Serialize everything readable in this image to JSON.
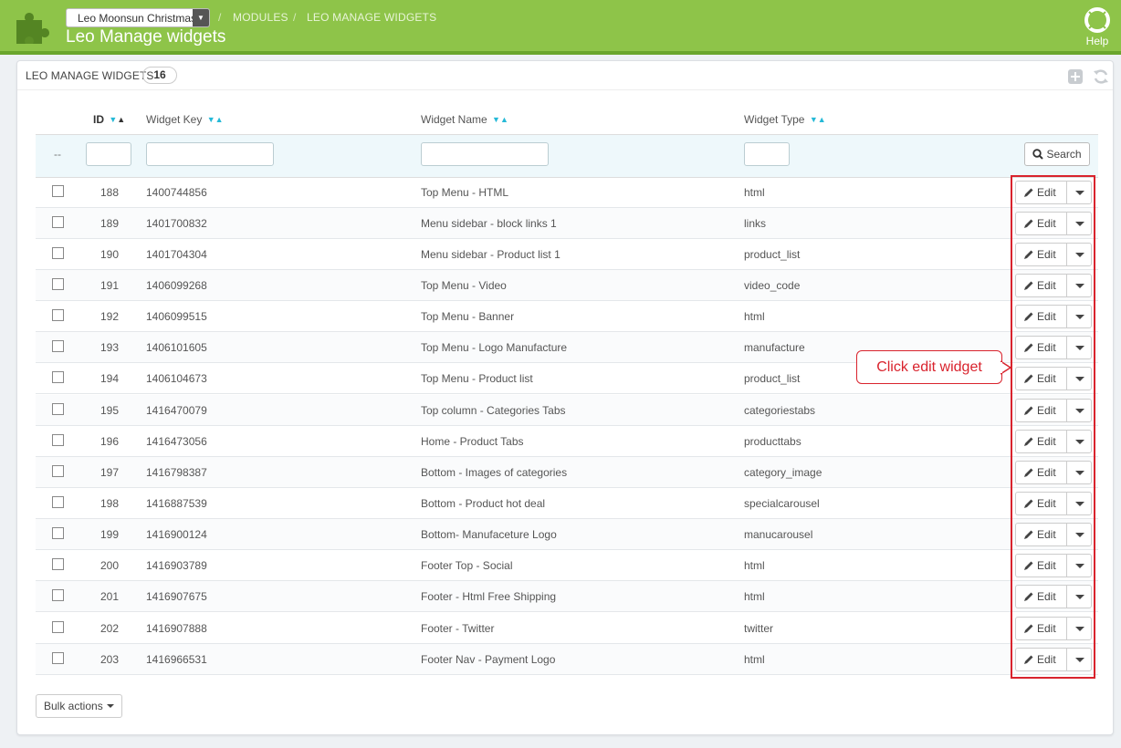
{
  "header": {
    "shop_select": "Leo Moonsun Christmas",
    "breadcrumb": [
      "MODULES",
      "LEO MANAGE WIDGETS"
    ],
    "title": "Leo Manage widgets",
    "help_label": "Help"
  },
  "panel": {
    "title": "LEO MANAGE WIDGETS",
    "count": "16"
  },
  "table": {
    "columns": {
      "id": "ID",
      "widget_key": "Widget Key",
      "widget_name": "Widget Name",
      "widget_type": "Widget Type"
    },
    "filter_dash": "--",
    "search_label": "Search",
    "edit_label": "Edit",
    "rows": [
      {
        "id": "188",
        "key": "1400744856",
        "name": "Top Menu - HTML",
        "type": "html"
      },
      {
        "id": "189",
        "key": "1401700832",
        "name": "Menu sidebar - block links 1",
        "type": "links"
      },
      {
        "id": "190",
        "key": "1401704304",
        "name": "Menu sidebar - Product list 1",
        "type": "product_list"
      },
      {
        "id": "191",
        "key": "1406099268",
        "name": "Top Menu - Video",
        "type": "video_code"
      },
      {
        "id": "192",
        "key": "1406099515",
        "name": "Top Menu - Banner",
        "type": "html"
      },
      {
        "id": "193",
        "key": "1406101605",
        "name": "Top Menu - Logo Manufacture",
        "type": "manufacture"
      },
      {
        "id": "194",
        "key": "1406104673",
        "name": "Top Menu - Product list",
        "type": "product_list"
      },
      {
        "id": "195",
        "key": "1416470079",
        "name": "Top column - Categories Tabs",
        "type": "categoriestabs"
      },
      {
        "id": "196",
        "key": "1416473056",
        "name": "Home - Product Tabs",
        "type": "producttabs"
      },
      {
        "id": "197",
        "key": "1416798387",
        "name": "Bottom - Images of categories",
        "type": "category_image"
      },
      {
        "id": "198",
        "key": "1416887539",
        "name": "Bottom - Product hot deal",
        "type": "specialcarousel"
      },
      {
        "id": "199",
        "key": "1416900124",
        "name": "Bottom- Manufaceture Logo",
        "type": "manucarousel"
      },
      {
        "id": "200",
        "key": "1416903789",
        "name": "Footer Top - Social",
        "type": "html"
      },
      {
        "id": "201",
        "key": "1416907675",
        "name": "Footer - Html Free Shipping",
        "type": "html"
      },
      {
        "id": "202",
        "key": "1416907888",
        "name": "Footer - Twitter",
        "type": "twitter"
      },
      {
        "id": "203",
        "key": "1416966531",
        "name": "Footer Nav - Payment Logo",
        "type": "html"
      }
    ]
  },
  "bulk_actions_label": "Bulk actions",
  "annotation": {
    "callout_text": "Click edit widget"
  },
  "colors": {
    "header_green": "#8ec449",
    "accent_blue": "#25b9d7",
    "annotation_red": "#d9232d"
  },
  "icons": [
    "puzzle-icon",
    "help-ring-icon",
    "add-icon",
    "refresh-icon",
    "search-icon",
    "pencil-icon",
    "caret-down-icon"
  ]
}
